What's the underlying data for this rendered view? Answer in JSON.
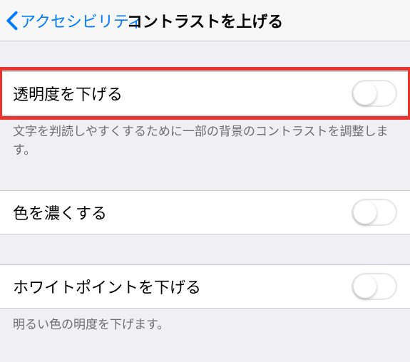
{
  "header": {
    "back_label": "アクセシビリティ",
    "title": "コントラストを上げる"
  },
  "rows": {
    "reduce_transparency": {
      "label": "透明度を下げる",
      "on": false
    },
    "darken_colors": {
      "label": "色を濃くする",
      "on": false
    },
    "reduce_white_point": {
      "label": "ホワイトポイントを下げる",
      "on": false
    }
  },
  "footers": {
    "reduce_transparency": "文字を判読しやすくするために一部の背景のコントラストを調整します。",
    "reduce_white_point": "明るい色の明度を下げます。"
  },
  "colors": {
    "accent": "#007aff",
    "highlight": "#e9332f"
  }
}
